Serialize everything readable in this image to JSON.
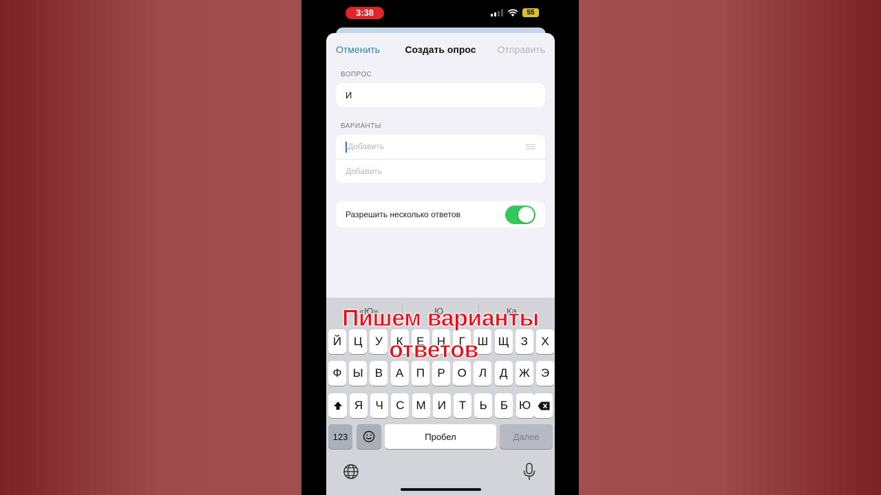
{
  "status_bar": {
    "time": "3:38",
    "battery": "55"
  },
  "nav": {
    "cancel": "Отменить",
    "title": "Создать опрос",
    "send": "Отправить"
  },
  "question": {
    "label": "ВОПРОС",
    "value": "И"
  },
  "options": {
    "label": "ВАРИАНТЫ",
    "placeholder1": "Добавить",
    "placeholder2": "Добавить"
  },
  "settings": {
    "multiple_answers": "Разрешить несколько ответов",
    "multiple_answers_on": true
  },
  "suggestions": [
    "«Ю»",
    "Ю",
    "Ка"
  ],
  "keyboard": {
    "row1": [
      "Й",
      "Ц",
      "У",
      "К",
      "Е",
      "Н",
      "Г",
      "Ш",
      "Щ",
      "З",
      "Х"
    ],
    "row2": [
      "Ф",
      "Ы",
      "В",
      "А",
      "П",
      "Р",
      "О",
      "Л",
      "Д",
      "Ж",
      "Э"
    ],
    "row3": [
      "Я",
      "Ч",
      "С",
      "М",
      "И",
      "Т",
      "Ь",
      "Б",
      "Ю"
    ],
    "numbers": "123",
    "space": "Пробел",
    "next": "Далее"
  },
  "overlay": {
    "line1": "Пишем варианты",
    "line2": "ответов"
  },
  "colors": {
    "accent": "#2f82a6",
    "toggle_on": "#34c759",
    "overlay_text": "#e3111c",
    "time_pill": "#e0262b"
  }
}
